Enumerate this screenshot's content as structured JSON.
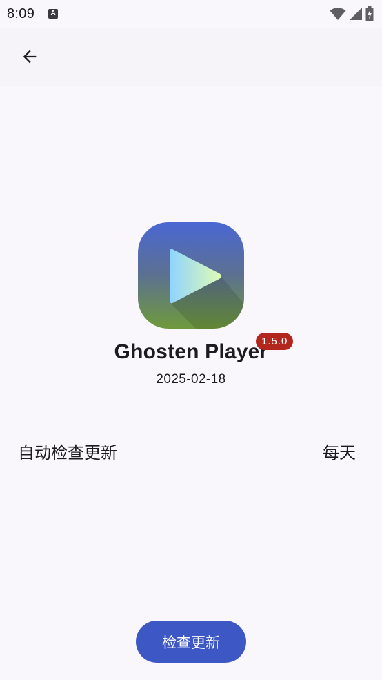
{
  "status_bar": {
    "time": "8:09",
    "notification_icon": "A",
    "icons": [
      "wifi-icon",
      "cell-signal-icon",
      "battery-charging-icon"
    ]
  },
  "app_bar": {
    "back_icon": "arrow-back-icon"
  },
  "app": {
    "name": "Ghosten Player",
    "version": "1.5.0",
    "release_date": "2025-02-18",
    "icon": "play-icon"
  },
  "settings": {
    "auto_check_label": "自动检查更新",
    "auto_check_value": "每天"
  },
  "actions": {
    "check_update_label": "检查更新"
  },
  "colors": {
    "background": "#f9f7fc",
    "badge": "#b3261e",
    "primary_button": "#3d57c4"
  }
}
